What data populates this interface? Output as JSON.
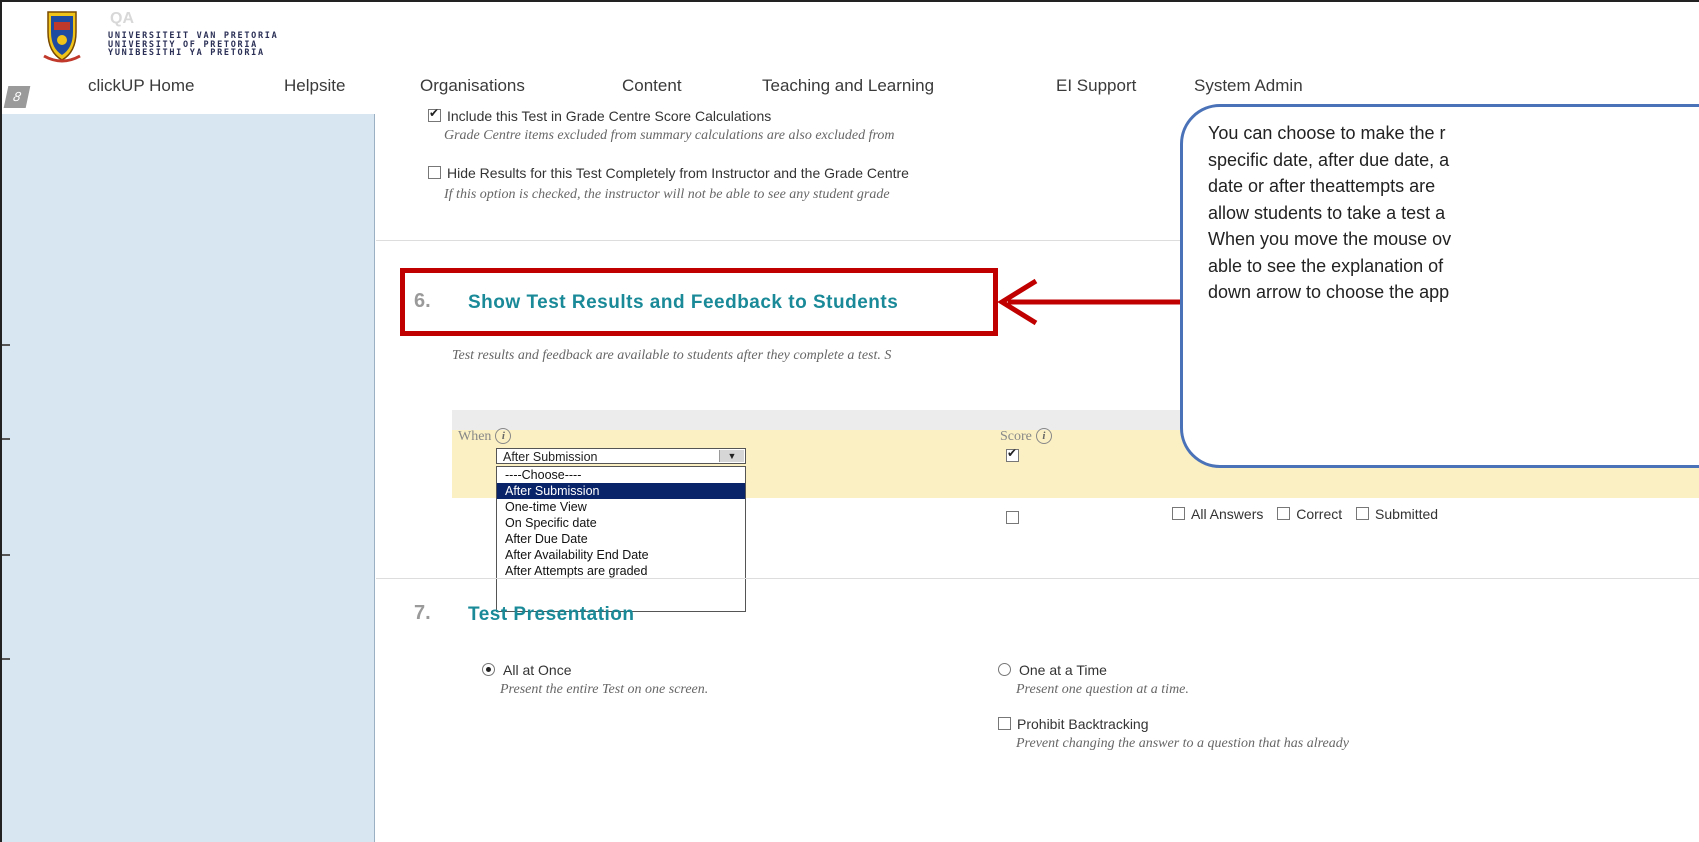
{
  "header": {
    "qa_label": "QA",
    "university_lines": [
      "UNIVERSITEIT VAN PRETORIA",
      "UNIVERSITY OF PRETORIA",
      "YUNIBESITHI YA PRETORIA"
    ],
    "badge": "8"
  },
  "nav": {
    "items": [
      "clickUP Home",
      "Helpsite",
      "Organisations",
      "Content",
      "Teaching and Learning",
      "EI Support",
      "System Admin"
    ]
  },
  "grade_options": {
    "include_label": "Include this Test in Grade Centre Score Calculations",
    "include_hint": "Grade Centre items excluded from summary calculations are also excluded from",
    "hide_label": "Hide Results for this Test Completely from Instructor and the Grade Centre",
    "hide_hint": "If this option is checked, the instructor will not be able to see any student grade"
  },
  "section6": {
    "number": "6.",
    "title": "Show Test Results and Feedback to Students",
    "hint": "Test results and feedback are available to students after they complete a test. S",
    "col_when": "When",
    "col_score": "Score",
    "select_value": "After Submission",
    "dropdown_options": [
      "----Choose----",
      "After Submission",
      "One-time View",
      "On Specific date",
      "After Due Date",
      "After Availability End Date",
      "After Attempts are graded"
    ],
    "selected_index": 1,
    "row2_options": [
      "All Answers",
      "Correct",
      "Submitted"
    ]
  },
  "section7": {
    "number": "7.",
    "title": "Test Presentation",
    "all_at_once_label": "All at Once",
    "all_at_once_hint": "Present the entire Test on one screen.",
    "one_at_time_label": "One at a Time",
    "one_at_time_hint": "Present one question at a time.",
    "prohibit_label": "Prohibit Backtracking",
    "prohibit_hint": "Prevent changing the answer to a question that has already"
  },
  "callout": {
    "lines": [
      "You can choose to make the r",
      "specific date, after due date, a",
      "date or after theattempts are",
      "allow students to take a test a",
      "When you move the mouse ov",
      "able to see the explanation of",
      "down arrow to choose the app"
    ]
  },
  "colors": {
    "accent": "#1a8a99",
    "highlight": "#c00000",
    "callout_border": "#4a72b8",
    "sidebar": "#d8e6f2",
    "selected_row": "#fbf0c3"
  }
}
